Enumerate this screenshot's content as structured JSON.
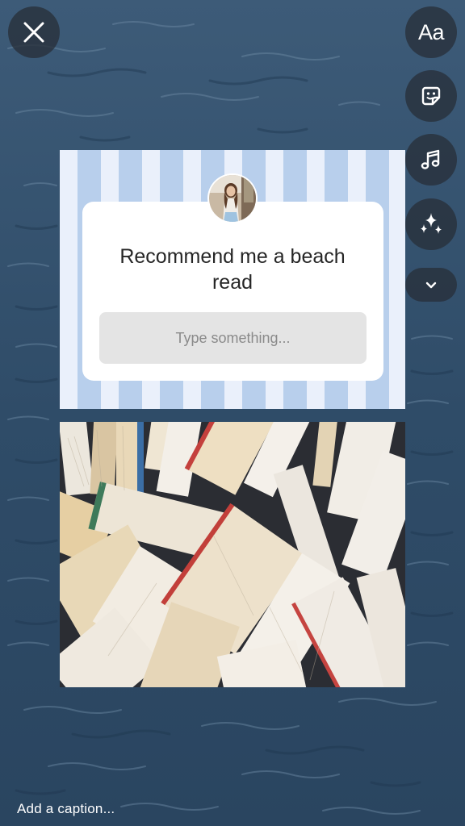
{
  "story_editor": {
    "toolbar": {
      "close_icon": "close-icon",
      "text_label": "Aa",
      "sticker_icon": "sticker-icon",
      "music_icon": "music-note-icon",
      "effects_icon": "sparkles-icon",
      "more_icon": "chevron-down-icon"
    },
    "question_sticker": {
      "prompt": "Recommend me a beach read",
      "answer_placeholder": "Type something..."
    },
    "caption": {
      "placeholder": "Add a caption..."
    }
  },
  "colors": {
    "stripe_light": "#eaf0fb",
    "stripe_blue": "#b8cfec",
    "water": "#34506a",
    "button_bg": "#28303a"
  }
}
